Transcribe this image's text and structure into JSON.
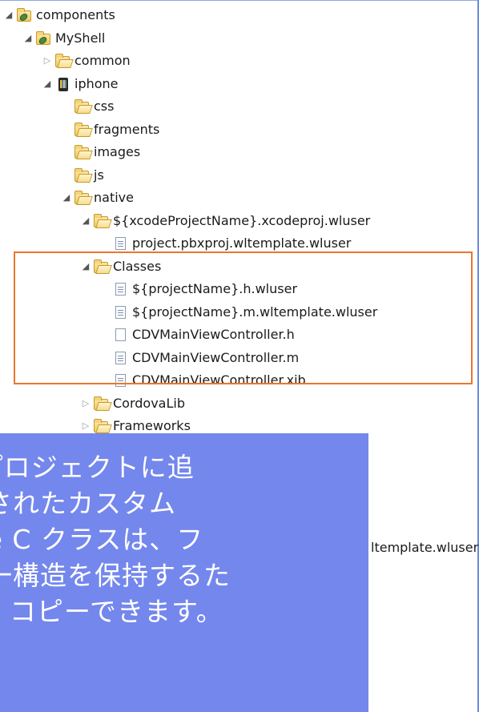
{
  "tree": [
    {
      "label": "components",
      "depth": 0,
      "twisty": "expanded",
      "icon": "project-folder-icon"
    },
    {
      "label": "MyShell",
      "depth": 1,
      "twisty": "expanded",
      "icon": "project-folder-icon"
    },
    {
      "label": "common",
      "depth": 2,
      "twisty": "collapsed",
      "icon": "folder-icon"
    },
    {
      "label": "iphone",
      "depth": 2,
      "twisty": "expanded",
      "icon": "iphone-icon"
    },
    {
      "label": "css",
      "depth": 3,
      "twisty": "none",
      "icon": "folder-icon"
    },
    {
      "label": "fragments",
      "depth": 3,
      "twisty": "none",
      "icon": "folder-icon"
    },
    {
      "label": "images",
      "depth": 3,
      "twisty": "none",
      "icon": "folder-icon"
    },
    {
      "label": "js",
      "depth": 3,
      "twisty": "none",
      "icon": "folder-icon"
    },
    {
      "label": "native",
      "depth": 3,
      "twisty": "expanded",
      "icon": "open-folder-icon"
    },
    {
      "label": "${xcodeProjectName}.xcodeproj.wluser",
      "depth": 4,
      "twisty": "expanded",
      "icon": "open-folder-icon"
    },
    {
      "label": "project.pbxproj.wltemplate.wluser",
      "depth": 5,
      "twisty": "none",
      "icon": "text-file-icon"
    },
    {
      "label": "Classes",
      "depth": 4,
      "twisty": "expanded",
      "icon": "open-folder-icon"
    },
    {
      "label": "${projectName}.h.wluser",
      "depth": 5,
      "twisty": "none",
      "icon": "text-file-icon"
    },
    {
      "label": "${projectName}.m.wltemplate.wluser",
      "depth": 5,
      "twisty": "none",
      "icon": "text-file-icon"
    },
    {
      "label": "CDVMainViewController.h",
      "depth": 5,
      "twisty": "none",
      "icon": "blank-file-icon"
    },
    {
      "label": "CDVMainViewController.m",
      "depth": 5,
      "twisty": "none",
      "icon": "text-file-icon"
    },
    {
      "label": "CDVMainViewController.xib",
      "depth": 5,
      "twisty": "none",
      "icon": "text-file-icon"
    },
    {
      "label": "CordovaLib",
      "depth": 4,
      "twisty": "collapsed",
      "icon": "folder-icon"
    },
    {
      "label": "Frameworks",
      "depth": 4,
      "twisty": "collapsed",
      "icon": "folder-icon"
    }
  ],
  "partial_row_label": "ltemplate.wluser",
  "overlay": {
    "lines": [
      "e プロジェクトに追",
      "されたカスタム",
      "tive C クラスは、フ",
      "一構造を保持するた",
      "コピーできます。"
    ]
  },
  "colors": {
    "highlight_border": "#e8772e",
    "overlay_background": "#6e82eb",
    "panel_border": "#6a8bd9"
  }
}
